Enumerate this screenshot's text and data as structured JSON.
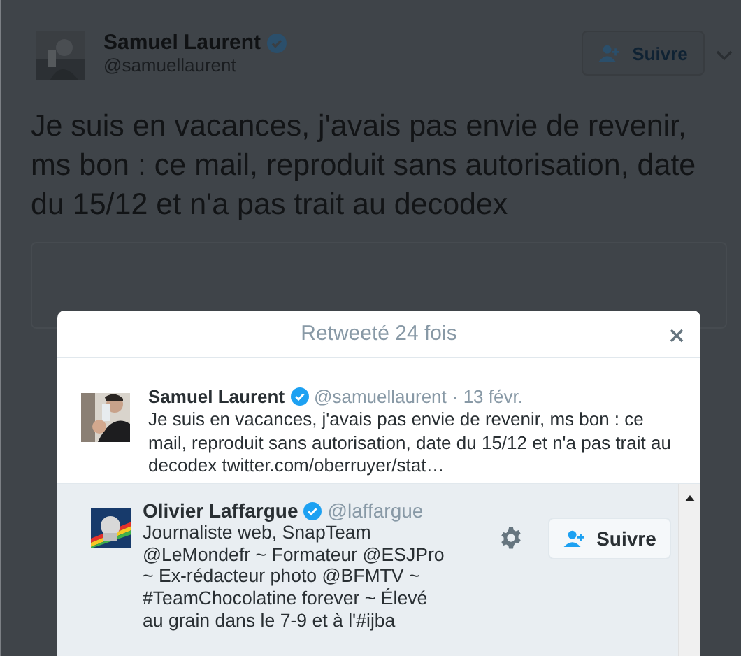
{
  "background_tweet": {
    "author": {
      "name": "Samuel Laurent",
      "handle": "@samuellaurent",
      "verified": true
    },
    "follow_button": "Suivre",
    "text": "Je suis en vacances, j'avais pas envie de revenir, ms bon : ce mail, reproduit sans autorisation, date du 15/12 et n'a pas trait au decodex"
  },
  "modal": {
    "title": "Retweeté 24 fois",
    "tweet": {
      "name": "Samuel Laurent",
      "verified": true,
      "handle": "@samuellaurent",
      "date": "· 13 févr.",
      "text": "Je suis en vacances, j'avais pas envie de revenir, ms bon : ce mail, reproduit sans autorisation, date du 15/12 et n'a pas trait au decodex",
      "link": "twitter.com/oberruyer/stat…"
    },
    "users": [
      {
        "name": "Olivier Laffargue",
        "verified": true,
        "handle": "@laffargue",
        "bio": "Journaliste web, SnapTeam @LeMondefr ~ Formateur @ESJPro ~ Ex-rédacteur photo @BFMTV ~ #TeamChocolatine forever ~ Élevé au grain dans le 7-9 et à l'#ijba",
        "follow_button": "Suivre"
      }
    ]
  }
}
